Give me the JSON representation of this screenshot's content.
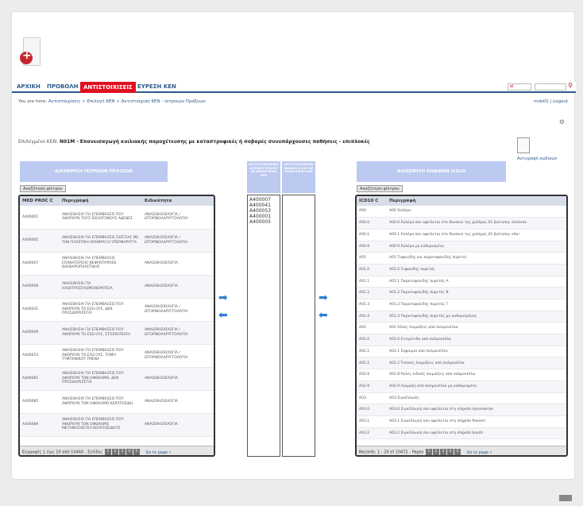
{
  "nav": {
    "items": [
      "ΑΡΧΙΚΗ",
      "ΠΡΟΒΟΛΗ",
      "ΑΝΤΙΣΤΟΙΧΙΣΕΙΣ",
      "ΕΥΡΕΣΗ ΚΕΝ"
    ],
    "active_index": 2
  },
  "language": {
    "value": "el"
  },
  "breadcrumb": "Αντιστοιχίσεις > Επιλογή ΚΕΝ > Αντιστοίχιση ΚΕΝ - Ιατρικών Πράξεων",
  "breadcrumb_prefix": "You are here:",
  "user": "mds01 | Logout",
  "selected": {
    "prefix": "Επιλεγμένο ΚΕΝ:",
    "code": "N01M",
    "text": "- Επανεισαγωγή κοιλιακής παροχέτευσης με καταστροφικές ή σοβαρές συνυπάρχουσες παθήσεις - επιπλοκές"
  },
  "copy_label": "Αντιγραφή κωδικών",
  "left_panel": {
    "header": "ΔΙΑΧΕΙΡΙΣΗ ΙΑΤΡΙΚΩΝ ΠΡΑΞΕΩΝ",
    "filter_button": "Αναζήτηση φίλτρου",
    "columns": [
      "MED PROC C",
      "Περιγραφή",
      "Ειδικότητα"
    ],
    "rows": [
      [
        "A400001",
        "ΑΝΑΙΣΘΗΣΙΑ ΓΙΑ ΕΠΕΜΒΑΣΕΙΣ ΠΟΥ ΑΦΟΡΟΥΝ ΤΟΥΣ ΣΙΕΛΟΓΟΝΟΥΣ ΑΔΕΝΕΣ",
        "ΑΝΑΙΣΘΗΣΙΟΛΟΓΙΑ / ΩΤΟΡΙΝΟΛΑΡΥΓΓΟΛΟΓΙΑ"
      ],
      [
        "A400005",
        "ΑΝΑΙΣΘΗΣΙΑ ΓΙΑ ΕΠΕΜΒΑΣΕΙΣ ΣΧΙΣΤΙΑΣ ΜΕ ΤΗΝ ΠΛΑΣΤΙΚΗ ΑΠΟΦΡΑΞΗ ΥΠΕΡΦΑΡΥΓΓΑ",
        "ΑΝΑΙΣΘΗΣΙΟΛΟΓΙΑ / ΩΤΟΡΙΝΟΛΑΡΥΓΓΟΛΟΓΙΑ"
      ],
      [
        "A400007",
        "ΑΝΑΙΣΘΗΣΙΑ ΓΙΑ ΕΠΕΜΒΑΣΕΙΣ ΕΠΑΝΑΓΕΡΣΗΣ ΝΕΦΡΟΠΥΡΟΕΚ ΒΛΕΦΑΡΟΠΛΑΣΤΙΚΗΣ",
        "ΑΝΑΙΣΘΗΣΙΟΛΟΓΙΑ"
      ],
      [
        "A400008",
        "ΑΝΑΙΣΘΗΣΙΑ ΓΙΑ ΗΛΕΚΤΡΟΣΠΑΣΜΟΘΕΡΑΠΕΙΑ",
        "ΑΝΑΙΣΘΗΣΙΟΛΟΓΙΑ"
      ],
      [
        "A400041",
        "ΑΝΑΙΣΘΗΣΙΑ ΓΙΑ ΕΠΕΜΒΑΣΕΙΣ ΠΟΥ ΑΦΟΡΟΥΝ ΤΟ ΕΣΩ ΟΥΣ, ΔΕΝ ΠΡΟΣΔΙΟΡΙΖΕΤΑΙ",
        "ΑΝΑΙΣΘΗΣΙΟΛΟΓΙΑ / ΩΤΟΡΙΝΟΛΑΡΥΓΓΟΛΟΓΙΑ"
      ],
      [
        "A400049",
        "ΑΝΑΙΣΘΗΣΙΑ ΓΙΑ ΕΠΕΜΒΑΣΕΙΣ ΠΟΥ ΑΦΟΡΟΥΝ ΤΟ ΕΣΩ ΟΥΣ, ΣΤΟΣΚΟΠΗΣΗ",
        "ΑΝΑΙΣΘΗΣΙΟΛΟΓΙΑ / ΩΤΟΡΙΝΟΛΑΡΥΓΓΟΛΟΓΙΑ"
      ],
      [
        "A400053",
        "ΑΝΑΙΣΘΗΣΙΑ ΓΙΑ ΕΠΕΜΒΑΣΕΙΣ ΠΟΥ ΑΦΟΡΟΥΝ ΤΟ ΕΣΩ ΟΥΣ, ΤΟΜΗ ΤΥΜΠΑΝΙΚΟΥ ΥΜΕΝΑ",
        "ΑΝΑΙΣΘΗΣΙΟΛΟΓΙΑ / ΩΤΟΡΙΝΟΛΑΡΥΓΓΟΛΟΓΙΑ"
      ],
      [
        "A400081",
        "ΑΝΑΙΣΘΗΣΙΑ ΓΙΑ ΕΠΕΜΒΑΣΕΙΣ ΠΟΥ ΑΦΟΡΟΥΝ ΤΟΝ ΟΦΘΑΛΜΟ, ΔΕΝ ΠΡΟΣΔΙΟΡΙΖΕΤΑΙ",
        "ΑΝΑΙΣΘΗΣΙΟΛΟΓΙΑ"
      ],
      [
        "A400085",
        "ΑΝΑΙΣΘΗΣΙΑ ΓΙΑ ΕΠΕΜΒΑΣΕΙΣ ΠΟΥ ΑΦΟΡΟΥΝ ΤΟΝ ΟΦΘΑΛΜΟ ΚΕΡΑΤΟΕΙΔΗ",
        "ΑΝΑΙΣΘΗΣΙΟΛΟΓΙΑ"
      ],
      [
        "A400089",
        "ΑΝΑΙΣΘΗΣΙΑ ΓΙΑ ΕΠΕΜΒΑΣΕΙΣ ΠΟΥ ΑΦΟΡΟΥΝ ΤΟΝ ΟΦΘΑΛΜΟ ΜΕΤΑΜΟΣΧΕΥΣΗ ΚΕΡΑΤΟΕΙΔΟΥΣ",
        "ΑΝΑΙΣΘΗΣΙΟΛΟΓΙΑ"
      ]
    ],
    "pager_text": "Εγγραφές 1 έως 10 από 10460 - Σελίδες",
    "pages": [
      "1",
      "2",
      "3",
      "4",
      "5"
    ],
    "goto": "Go to page »"
  },
  "mid": {
    "header_left": "ΑΝΤΙΣΤΟΙΧΙΣΜΕΝΕΣ ΙΑΤΡΙΚΕΣ ΠΡΑΞΕΙΣ ΜΕ ΕΠΙΛΕΓΜΕΝΟ ΚΕΝ",
    "header_right": "ΑΝΤΙΣΤΟΙΧΙΣΜΕΝΟΙ ΚΩΔΙΚΟΙ ICD10 ΜΕ ΕΠΙΛΕΓΜΕΝΟ ΚΕΝ",
    "codes": [
      "A400007",
      "A400041",
      "A400053",
      "A400001",
      "A400005"
    ]
  },
  "right_panel": {
    "header": "ΔΙΑΧΕΙΡΙΣΗ ΚΩΔΙΚΩΝ ICD10",
    "filter_button": "Αναζήτηση φίλτρου",
    "columns": [
      "ICD10 C",
      "Περιγραφή"
    ],
    "rows": [
      [
        "A00",
        "A00 Χολέρα"
      ],
      [
        "A00.0",
        "A00.0 Χολέρα που οφείλεται στο δονάκιο της χολέρας 01 βιότυπος cholerae"
      ],
      [
        "A00.1",
        "A00.1 Χολέρα που οφείλεται στο δονάκιο της χολέρας 01 βιότυπος eltor"
      ],
      [
        "A00.9",
        "A00.9 Χολέρα μη καθορισμένη"
      ],
      [
        "A01",
        "A01 Τυφοειδής και παρατυφοειδής πυρετοί"
      ],
      [
        "A01.0",
        "A01.0 Τυφοειδής πυρετός"
      ],
      [
        "A01.1",
        "A01.1 Παρατυφοειδής πυρετός Α"
      ],
      [
        "A01.2",
        "A01.2 Παρατυφοειδής πυρετός Β"
      ],
      [
        "A01.3",
        "A01.3 Παρατυφοειδής πυρετός Γ"
      ],
      [
        "A01.4",
        "A01.4 Παρατυφοειδής πυρετός μη καθορισμένος"
      ],
      [
        "A02",
        "A02 Άλλες λοιμώξεις από σαλμονέλλα"
      ],
      [
        "A02.0",
        "A02.0 Εντερίτιδα από σαλμονέλλα"
      ],
      [
        "A02.1",
        "A02.1 Σηψαιμία από σαλμονέλλα"
      ],
      [
        "A02.2",
        "A02.2 Τοπικές λοιμώξεις από σαλμονέλλα"
      ],
      [
        "A02.8",
        "A02.8 Άλλες ειδικές λοιμώξεις από σαλμονέλλα"
      ],
      [
        "A02.9",
        "A02.9 Λοίμωξη από σαλμονέλλα μη καθορισμένη"
      ],
      [
        "A03",
        "A03 Σιγκέλλωση"
      ],
      [
        "A03.0",
        "A03.0 Σιγκέλλωση που οφείλεται στη shigella dysenteriae"
      ],
      [
        "A03.1",
        "A03.1 Σιγκέλλωση που οφείλεται στη shigella flexneri"
      ],
      [
        "A03.2",
        "A03.2 Σιγκέλλωση που οφείλεται στη shigella boydii"
      ]
    ],
    "pager_text": "Records: 1 - 20 of 10472 - Pages",
    "pages": [
      "1",
      "2",
      "3",
      "4",
      "5"
    ],
    "goto": "Go to page »"
  }
}
